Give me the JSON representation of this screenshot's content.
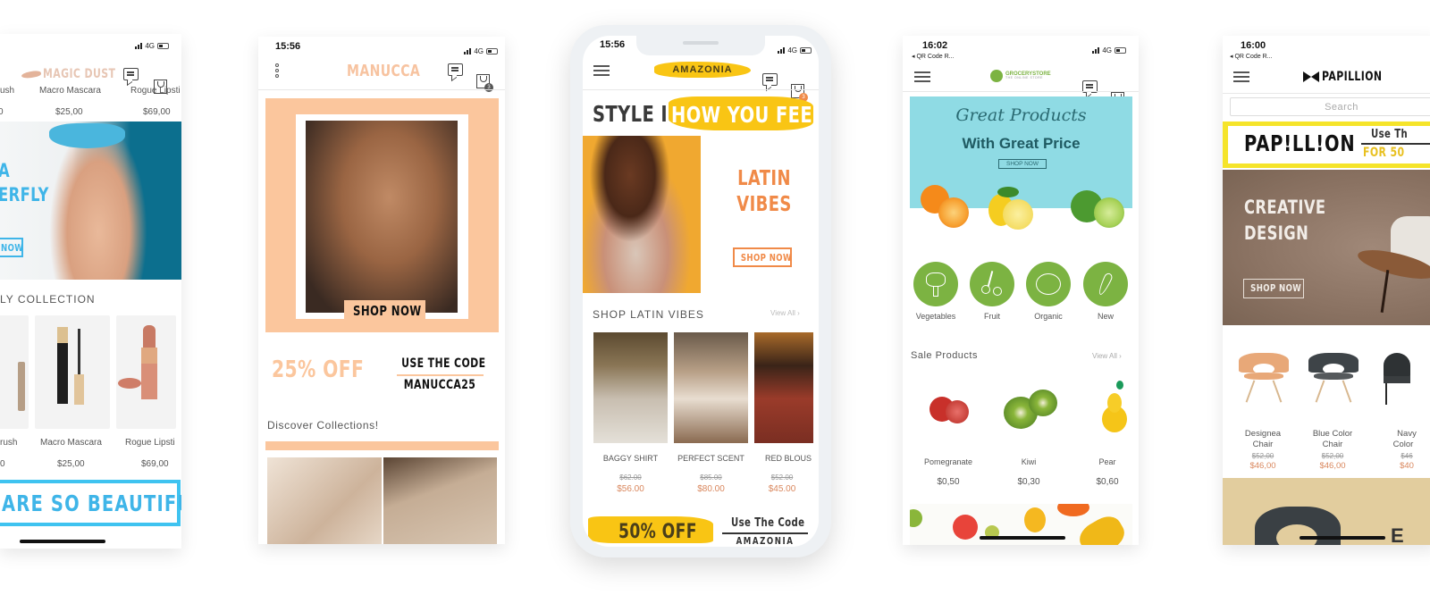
{
  "screens": {
    "magic_dust": {
      "brand": "MAGIC DUST",
      "status": {
        "network": "4G"
      },
      "top_products": [
        {
          "name": "ush",
          "price": "0"
        },
        {
          "name": "Macro Mascara",
          "price": "$25,00"
        },
        {
          "name": "Rogue Lipsti",
          "price": "$69,00"
        }
      ],
      "hero": {
        "line1": "A",
        "line2": "ERFLY",
        "button": "NOW"
      },
      "section_title": "LY COLLECTION",
      "products": [
        {
          "name": "rush",
          "price": "0"
        },
        {
          "name": "Macro Mascara",
          "price": "$25,00"
        },
        {
          "name": "Rogue Lipsti",
          "price": "$69,00"
        }
      ],
      "banner": "ARE SO BEAUTIFUL"
    },
    "manucca": {
      "time": "15:56",
      "status": {
        "network": "4G"
      },
      "brand": "MANUCCA",
      "cart_count": "3",
      "hero_button": "SHOP NOW",
      "promo": {
        "discount": "25% OFF",
        "code_label": "USE THE CODE",
        "code": "MANUCCA25"
      },
      "section_title": "Discover Collections!"
    },
    "amazonia": {
      "time": "15:56",
      "status": {
        "network": "4G"
      },
      "brand": "AMAZONIA",
      "cart_count": "3",
      "headline_dark": "STYLE IS",
      "headline_highlight": "HOW YOU FEEL",
      "hero": {
        "line1": "LATIN",
        "line2": "VIBES",
        "button": "SHOP NOW"
      },
      "section_title": "SHOP LATIN VIBES",
      "view_all": "View All",
      "products": [
        {
          "name": "BAGGY SHIRT",
          "old_price": "$62.00",
          "price": "$56.00"
        },
        {
          "name": "PERFECT SCENT",
          "old_price": "$85.00",
          "price": "$80.00"
        },
        {
          "name": "RED BLOUS",
          "old_price": "$52.00",
          "price": "$45.00"
        }
      ],
      "promo": {
        "discount": "50% OFF",
        "code_label": "Use The Code",
        "code": "AMAZONIA"
      }
    },
    "grocery": {
      "time": "16:02",
      "back_label": "◂ QR Code R...",
      "status": {
        "network": "4G"
      },
      "brand": "GROCERYSTORE",
      "brand_sub": "THE ONLINE STORE",
      "hero": {
        "script": "Great Products",
        "title": "With Great Price",
        "button": "SHOP NOW"
      },
      "categories": [
        {
          "label": "Vegetables",
          "icon": "broccoli-icon"
        },
        {
          "label": "Fruit",
          "icon": "cherry-icon"
        },
        {
          "label": "Organic",
          "icon": "tomato-icon"
        },
        {
          "label": "New",
          "icon": "carrot-icon"
        }
      ],
      "section_title": "Sale Products",
      "view_all": "View All",
      "products": [
        {
          "name": "Pomegranate",
          "price": "$0,50"
        },
        {
          "name": "Kiwi",
          "price": "$0,30"
        },
        {
          "name": "Pear",
          "price": "$0,60"
        }
      ],
      "accent": "#7cb342",
      "hero_bg": "#8fdbe4"
    },
    "papillion": {
      "time": "16:00",
      "back_label": "◂ QR Code R...",
      "brand": "PAPILLION",
      "search_placeholder": "Search",
      "promo": {
        "logo": "PAP!LL!ON",
        "code_label": "Use Th",
        "offer": "FOR 50"
      },
      "hero": {
        "line1": "CREATIVE",
        "line2": "DESIGN",
        "button": "SHOP NOW"
      },
      "products": [
        {
          "name1": "Designea",
          "name2": "Chair",
          "old_price": "$52,00",
          "price": "$46,00"
        },
        {
          "name1": "Blue Color",
          "name2": "Chair",
          "old_price": "$52,00",
          "price": "$46,00"
        },
        {
          "name1": "Navy",
          "name2": "Color",
          "old_price": "$46",
          "price": "$40"
        }
      ],
      "accent": "#f5e42a"
    }
  }
}
